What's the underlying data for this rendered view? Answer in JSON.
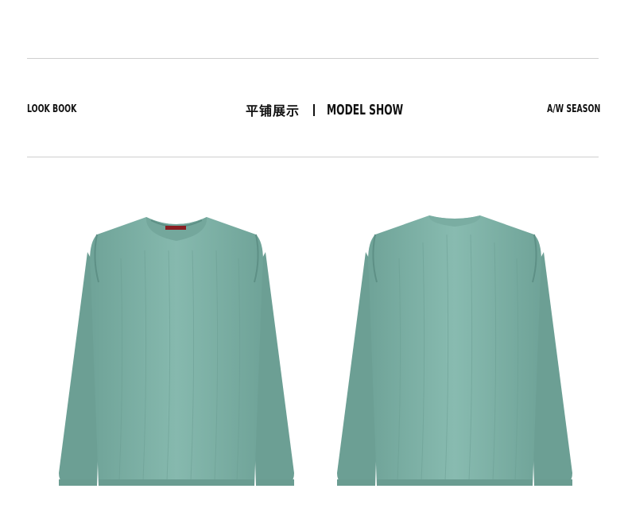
{
  "header": {
    "left_label": "LOOK BOOK",
    "center_cn": "平铺展示",
    "center_en": "MODEL SHOW",
    "right_label": "A/W SEASON"
  },
  "products": [
    {
      "view": "front",
      "color": "#7fb2a8"
    },
    {
      "view": "back",
      "color": "#7fb2a8"
    }
  ]
}
